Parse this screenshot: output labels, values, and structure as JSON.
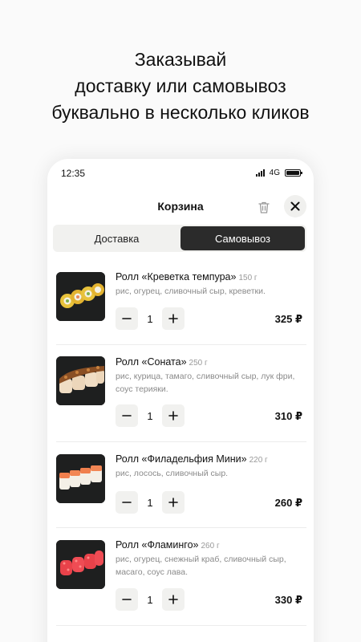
{
  "promo": {
    "line1": "Заказывай",
    "line2": "доставку или самовывоз",
    "line3": "буквально в несколько кликов"
  },
  "status_bar": {
    "time": "12:35",
    "network": "4G"
  },
  "header": {
    "title": "Корзина",
    "trash_icon": "trash-icon",
    "close_icon": "close-icon"
  },
  "tabs": [
    {
      "label": "Доставка",
      "active": false
    },
    {
      "label": "Самовывоз",
      "active": true
    }
  ],
  "cart": {
    "items": [
      {
        "name": "Ролл «Креветка темпура»",
        "weight": "150 г",
        "description": "рис, огурец, сливочный сыр, креветки.",
        "quantity": "1",
        "price": "325 ₽"
      },
      {
        "name": "Ролл «Соната»",
        "weight": "250 г",
        "description": "рис, курица, тамаго, сливочный сыр, лук фри, соус терияки.",
        "quantity": "1",
        "price": "310 ₽"
      },
      {
        "name": "Ролл «Филадельфия Мини»",
        "weight": "220 г",
        "description": "рис, лосось, сливочный сыр.",
        "quantity": "1",
        "price": "260 ₽"
      },
      {
        "name": "Ролл «Фламинго»",
        "weight": "260 г",
        "description": "рис, огурец, снежный краб, сливочный сыр, масаго, соус лава.",
        "quantity": "1",
        "price": "330 ₽"
      }
    ],
    "minus_icon": "minus-icon",
    "plus_icon": "plus-icon"
  }
}
